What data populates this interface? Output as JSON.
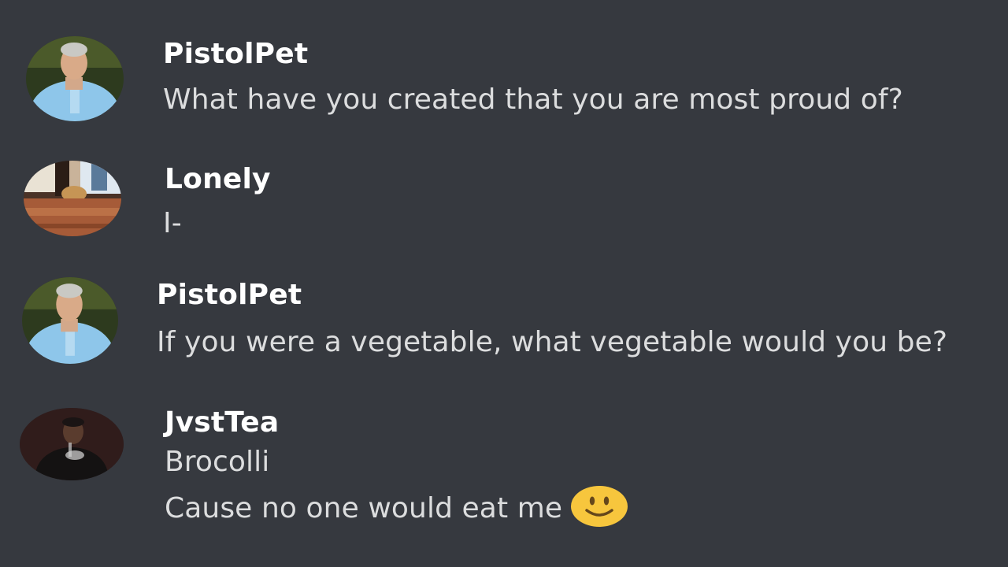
{
  "messages": [
    {
      "author": "PistolPet",
      "avatar_icon": "footballer-avatar-icon",
      "lines": [
        "What have you created that you are most proud of?"
      ]
    },
    {
      "author": "Lonely",
      "avatar_icon": "room-photo-avatar-icon",
      "lines": [
        "I-"
      ]
    },
    {
      "author": "PistolPet",
      "avatar_icon": "footballer-avatar-icon",
      "lines": [
        "If you were a vegetable, what vegetable would you be?"
      ]
    },
    {
      "author": "JvstTea",
      "avatar_icon": "person-dark-avatar-icon",
      "lines": [
        "Brocolli",
        "Cause no one would eat me"
      ],
      "emoji": "slightly-smiling-face-icon"
    }
  ],
  "colors": {
    "background": "#36393f",
    "author": "#ffffff",
    "text": "#dcddde",
    "jersey": "#8ec6ea",
    "emoji": "#f7c63d"
  }
}
